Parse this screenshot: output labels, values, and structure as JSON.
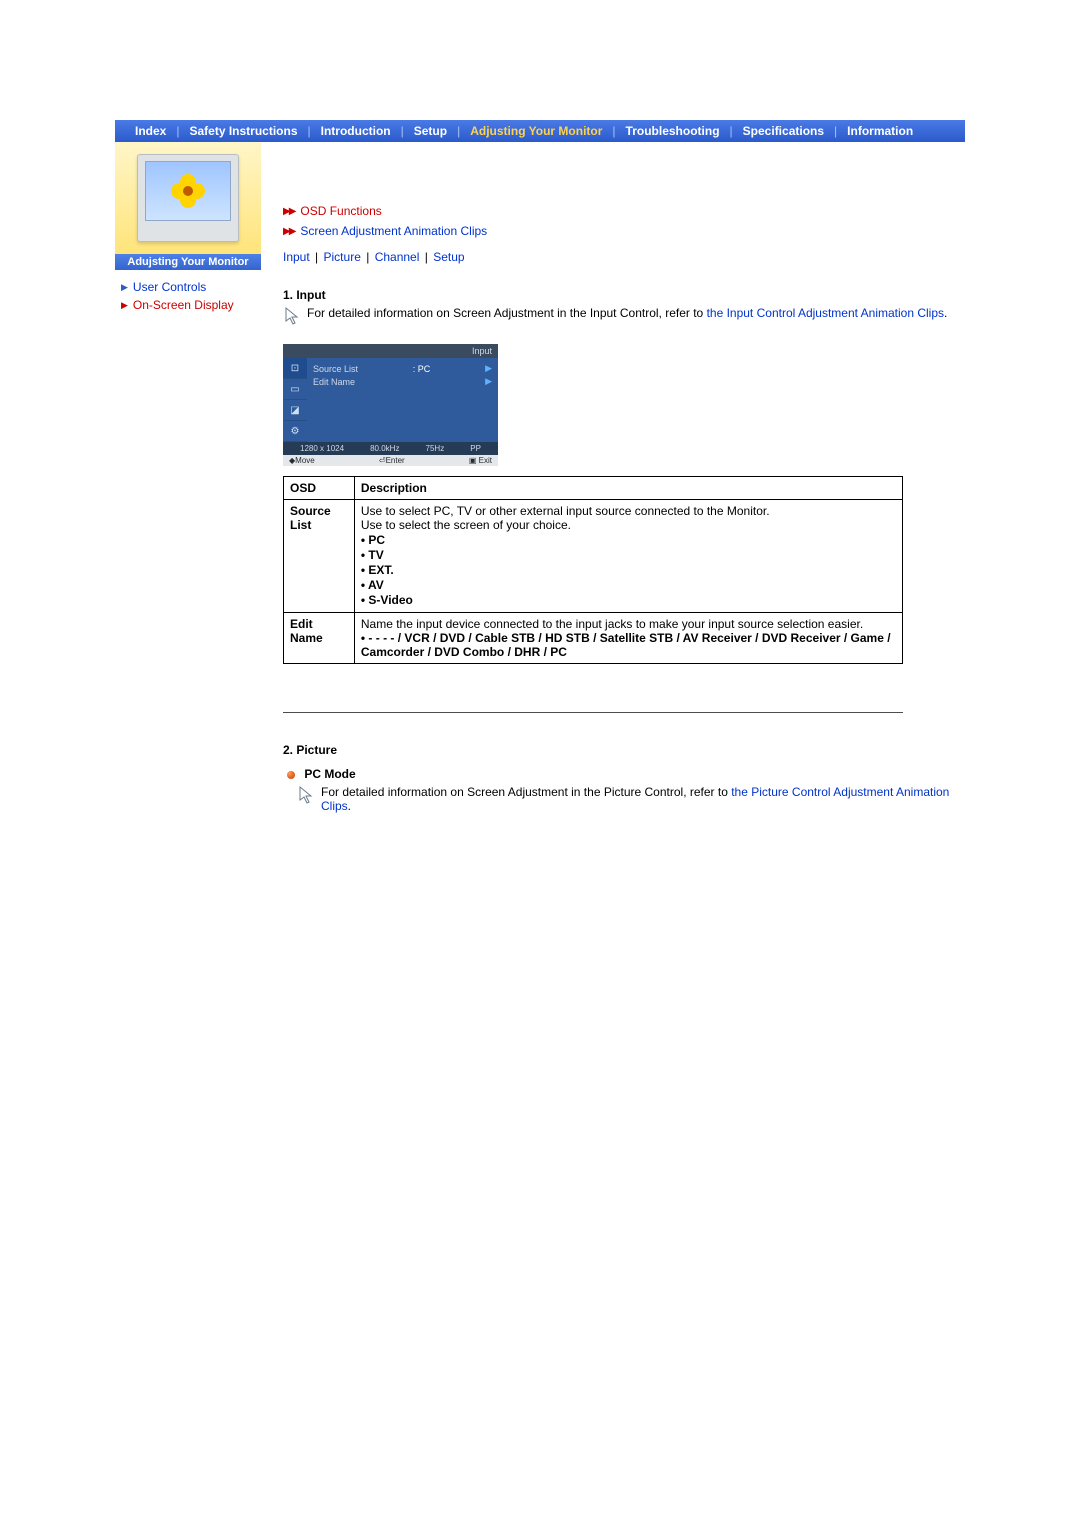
{
  "topnav": {
    "items": [
      "Index",
      "Safety Instructions",
      "Introduction",
      "Setup",
      "Adjusting Your Monitor",
      "Troubleshooting",
      "Specifications",
      "Information"
    ],
    "active_index": 4
  },
  "sidebar": {
    "header": "Adujsting Your Monitor",
    "links": [
      {
        "label": "User Controls",
        "style": "blue"
      },
      {
        "label": "On-Screen Display",
        "style": "red"
      }
    ]
  },
  "functions": {
    "osd_label": "OSD Functions",
    "anim_label": "Screen Adjustment Animation Clips"
  },
  "sublinks": [
    "Input",
    "Picture",
    "Channel",
    "Setup"
  ],
  "section1": {
    "heading": "1. Input",
    "note_prefix": "For detailed information on Screen Adjustment in the Input Control, refer to ",
    "note_link": "the Input Control Adjustment Animation Clips",
    "note_suffix": "."
  },
  "osd_panel": {
    "title": "Input",
    "lines": [
      {
        "label": "Source List",
        "value": ": PC"
      },
      {
        "label": "Edit Name",
        "value": ""
      }
    ],
    "status": [
      "1280 x 1024",
      "80.0kHz",
      "75Hz",
      "PP"
    ],
    "footer": [
      "◆Move",
      "⏎Enter",
      "▣ Exit"
    ]
  },
  "table": {
    "headers": [
      "OSD",
      "Description"
    ],
    "rows": [
      {
        "osd": "Source List",
        "desc_lines": [
          "Use to select PC, TV or other external input source connected to the Monitor.",
          "Use to select the screen of your choice."
        ],
        "bullets": [
          "PC",
          "TV",
          "EXT.",
          "AV",
          "S-Video"
        ]
      },
      {
        "osd": "Edit Name",
        "desc_lines": [
          "Name the input device connected to the input jacks to make your input source selection easier."
        ],
        "bold_bullet": "- - - - / VCR / DVD / Cable STB / HD STB / Satellite STB / AV Receiver / DVD Receiver / Game / Camcorder / DVD Combo / DHR / PC"
      }
    ]
  },
  "section2": {
    "heading": "2. Picture",
    "mode": "PC Mode",
    "note_prefix": "For detailed information on Screen Adjustment in the Picture Control, refer to ",
    "note_link": "the Picture Control Adjustment Animation Clips",
    "note_suffix": "."
  }
}
